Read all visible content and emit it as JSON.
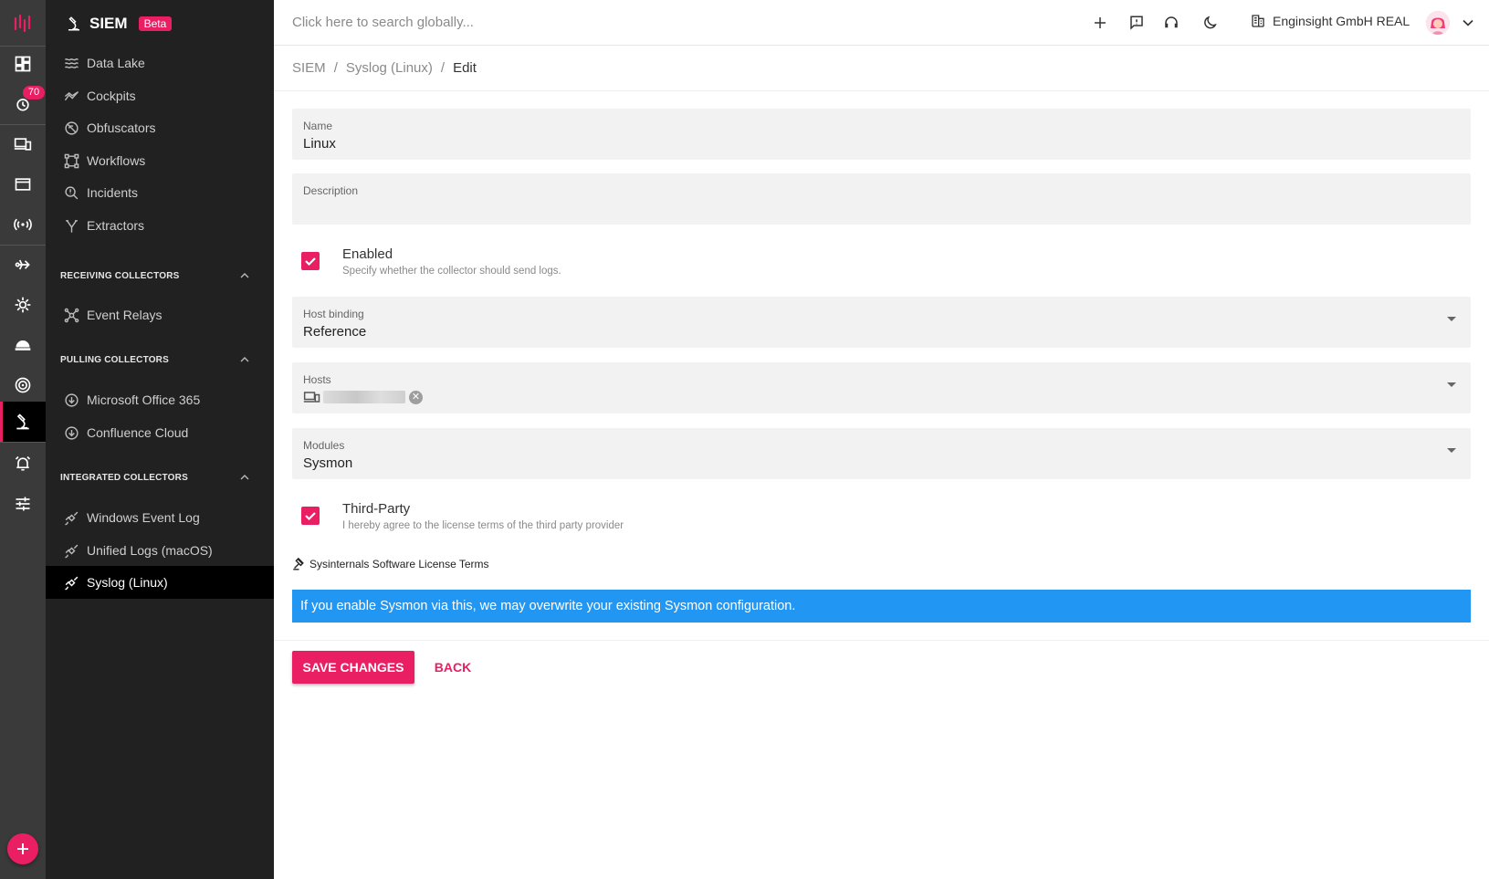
{
  "colors": {
    "accent": "#e91e63",
    "info": "#2196f3",
    "rail": "#3a3a3a",
    "sidebar": "#212121"
  },
  "rail": {
    "badge": "70",
    "icons": [
      "logo-icon",
      "dashboard-icon",
      "alerts-icon",
      "devices-icon",
      "window-icon",
      "radio-icon",
      "flow-icon",
      "gear-icon",
      "shield-icon",
      "radar-icon",
      "siem-icon",
      "alarm-icon",
      "sliders-icon",
      "add-icon"
    ]
  },
  "sidebar": {
    "title": "SIEM",
    "badge": "Beta",
    "items": [
      {
        "label": "Data Lake",
        "icon": "waves-icon"
      },
      {
        "label": "Cockpits",
        "icon": "chart-line-icon"
      },
      {
        "label": "Obfuscators",
        "icon": "eye-off-icon"
      },
      {
        "label": "Workflows",
        "icon": "workflow-icon"
      },
      {
        "label": "Incidents",
        "icon": "search-alert-icon"
      },
      {
        "label": "Extractors",
        "icon": "fork-icon"
      }
    ],
    "sections": [
      {
        "title": "RECEIVING COLLECTORS",
        "items": [
          {
            "label": "Event Relays",
            "icon": "hub-icon"
          }
        ]
      },
      {
        "title": "PULLING COLLECTORS",
        "items": [
          {
            "label": "Microsoft Office 365",
            "icon": "download-circle-icon"
          },
          {
            "label": "Confluence Cloud",
            "icon": "download-circle-icon"
          }
        ]
      },
      {
        "title": "INTEGRATED COLLECTORS",
        "items": [
          {
            "label": "Windows Event Log",
            "icon": "satellite-icon"
          },
          {
            "label": "Unified Logs (macOS)",
            "icon": "satellite-icon"
          },
          {
            "label": "Syslog (Linux)",
            "icon": "satellite-icon"
          }
        ]
      }
    ]
  },
  "topbar": {
    "search_placeholder": "Click here to search globally...",
    "org": "Enginsight GmbH REAL"
  },
  "breadcrumb": {
    "root": "SIEM",
    "parent": "Syslog (Linux)",
    "current": "Edit",
    "sep": "/"
  },
  "form": {
    "name": {
      "label": "Name",
      "value": "Linux"
    },
    "description": {
      "label": "Description",
      "value": ""
    },
    "enabled": {
      "title": "Enabled",
      "subtitle": "Specify whether the collector should send logs.",
      "checked": true
    },
    "host_binding": {
      "label": "Host binding",
      "value": "Reference"
    },
    "hosts": {
      "label": "Hosts"
    },
    "modules": {
      "label": "Modules",
      "value": "Sysmon"
    },
    "third_party": {
      "title": "Third-Party",
      "subtitle": "I hereby agree to the license terms of the third party provider",
      "checked": true
    },
    "license_link": "Sysinternals Software License Terms",
    "info": "If you enable Sysmon via this, we may overwrite your existing Sysmon configuration."
  },
  "actions": {
    "save": "SAVE CHANGES",
    "back": "BACK"
  }
}
